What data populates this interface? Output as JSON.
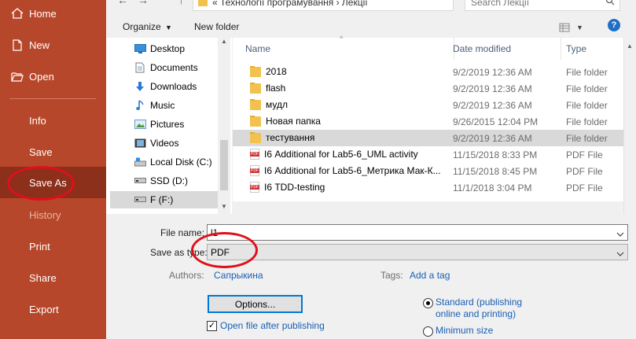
{
  "sidebar": {
    "items": [
      {
        "label": "Home",
        "icon": "home-icon"
      },
      {
        "label": "New",
        "icon": "new-document-icon"
      },
      {
        "label": "Open",
        "icon": "open-folder-icon"
      },
      {
        "label": "Info"
      },
      {
        "label": "Save"
      },
      {
        "label": "Save As"
      },
      {
        "label": "History"
      },
      {
        "label": "Print"
      },
      {
        "label": "Share"
      },
      {
        "label": "Export"
      }
    ],
    "bg_color": "#b7472a",
    "active_color": "#8c2f1b"
  },
  "address": {
    "path": "«  Технології програмування  ›  Лекції",
    "search_placeholder": "Search Лекції"
  },
  "toolbar": {
    "organize": "Organize",
    "new_folder": "New folder",
    "help": "?"
  },
  "nav": {
    "items": [
      {
        "label": "Desktop",
        "icon": "desktop-icon"
      },
      {
        "label": "Documents",
        "icon": "documents-icon"
      },
      {
        "label": "Downloads",
        "icon": "downloads-icon"
      },
      {
        "label": "Music",
        "icon": "music-icon"
      },
      {
        "label": "Pictures",
        "icon": "pictures-icon"
      },
      {
        "label": "Videos",
        "icon": "videos-icon"
      },
      {
        "label": "Local Disk (C:)",
        "icon": "drive-icon"
      },
      {
        "label": "SSD (D:)",
        "icon": "drive-icon"
      },
      {
        "label": "F (F:)",
        "icon": "drive-icon"
      }
    ]
  },
  "files": {
    "columns": [
      "Name",
      "Date modified",
      "Type"
    ],
    "rows": [
      {
        "name": "2018",
        "date": "9/2/2019 12:36 AM",
        "type": "File folder",
        "kind": "folder"
      },
      {
        "name": "flash",
        "date": "9/2/2019 12:36 AM",
        "type": "File folder",
        "kind": "folder"
      },
      {
        "name": "мудл",
        "date": "9/2/2019 12:36 AM",
        "type": "File folder",
        "kind": "folder"
      },
      {
        "name": "Новая папка",
        "date": "9/26/2015 12:04 PM",
        "type": "File folder",
        "kind": "folder"
      },
      {
        "name": "тестування",
        "date": "9/2/2019 12:36 AM",
        "type": "File folder",
        "kind": "folder"
      },
      {
        "name": "І6 Additional for Lab5-6_UML activity",
        "date": "11/15/2018 8:33 PM",
        "type": "PDF File",
        "kind": "pdf"
      },
      {
        "name": "І6 Additional for Lab5-6_Метрика Мак-К...",
        "date": "11/15/2018 8:45 PM",
        "type": "PDF File",
        "kind": "pdf"
      },
      {
        "name": "І6 TDD-testing",
        "date": "11/1/2018 3:04 PM",
        "type": "PDF File",
        "kind": "pdf"
      }
    ]
  },
  "save": {
    "file_name_label": "File name:",
    "file_name_value": "l1",
    "type_label": "Save as type:",
    "type_value": "PDF",
    "authors_label": "Authors:",
    "authors_value": "Сапрыкина",
    "tags_label": "Tags:",
    "tags_value": "Add a tag",
    "options_button": "Options...",
    "open_after_label": "Open file after publishing",
    "radio_standard": "Standard (publishing online and printing)",
    "radio_minimum": "Minimum size"
  },
  "annotation_color": "#e0101a"
}
